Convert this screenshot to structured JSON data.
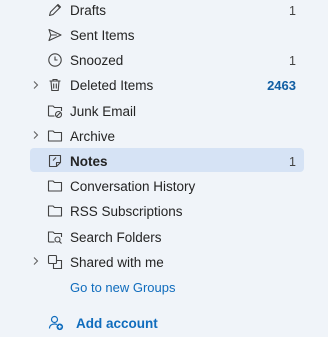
{
  "folders": [
    {
      "label": "Drafts",
      "count": "1",
      "icon": "pencil-icon"
    },
    {
      "label": "Sent Items",
      "count": "",
      "icon": "send-icon"
    },
    {
      "label": "Snoozed",
      "count": "1",
      "icon": "clock-icon"
    },
    {
      "label": "Deleted Items",
      "count": "2463",
      "icon": "trash-icon",
      "expandable": true
    },
    {
      "label": "Junk Email",
      "count": "",
      "icon": "junk-folder-icon"
    },
    {
      "label": "Archive",
      "count": "",
      "icon": "archive-icon",
      "expandable": true
    },
    {
      "label": "Notes",
      "count": "1",
      "icon": "note-icon",
      "selected": true
    },
    {
      "label": "Conversation History",
      "count": "",
      "icon": "folder-icon"
    },
    {
      "label": "RSS Subscriptions",
      "count": "",
      "icon": "folder-icon"
    },
    {
      "label": "Search Folders",
      "count": "",
      "icon": "search-folder-icon"
    },
    {
      "label": "Shared with me",
      "count": "",
      "icon": "shared-icon",
      "expandable": true
    }
  ],
  "groups_link": "Go to new Groups",
  "add_account": "Add account",
  "colors": {
    "accent": "#0f6cbd",
    "selected": "#d6e3f5",
    "unread": "#115ea3",
    "background": "#f0f4f9"
  }
}
